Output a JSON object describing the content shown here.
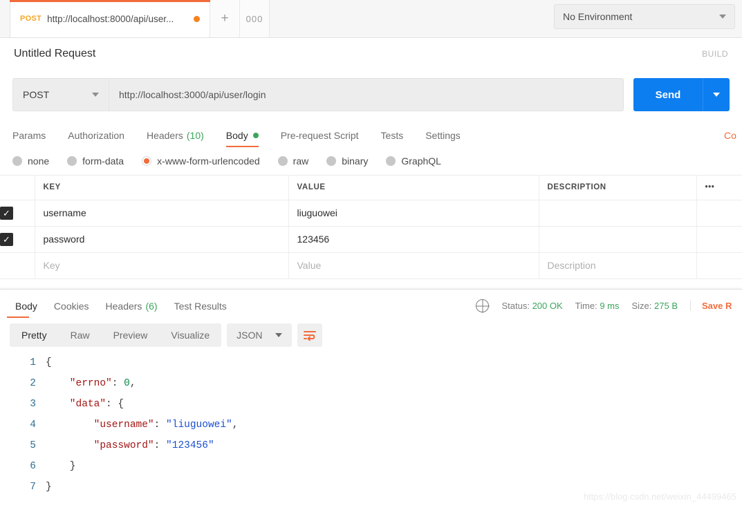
{
  "tabstrip": {
    "request_tab": {
      "method": "POST",
      "url": "http://localhost:8000/api/user...",
      "unsaved_icon": "orange-dot"
    },
    "new_tab_label": "+",
    "tab_options_label": "000",
    "environment": {
      "selected": "No Environment",
      "caret": "chevron-down-icon"
    }
  },
  "request": {
    "title": "Untitled Request",
    "build_label": "BUILD",
    "method": "POST",
    "url": "http://localhost:3000/api/user/login",
    "send_label": "Send",
    "tabs": [
      {
        "label": "Params",
        "count": "",
        "active": false
      },
      {
        "label": "Authorization",
        "count": "",
        "active": false
      },
      {
        "label": "Headers",
        "count": "(10)",
        "active": false
      },
      {
        "label": "Body",
        "count": "",
        "active": true
      },
      {
        "label": "Pre-request Script",
        "count": "",
        "active": false
      },
      {
        "label": "Tests",
        "count": "",
        "active": false
      },
      {
        "label": "Settings",
        "count": "",
        "active": false
      }
    ],
    "code_link": "Co",
    "body_types": [
      {
        "label": "none",
        "selected": false
      },
      {
        "label": "form-data",
        "selected": false
      },
      {
        "label": "x-www-form-urlencoded",
        "selected": true
      },
      {
        "label": "raw",
        "selected": false
      },
      {
        "label": "binary",
        "selected": false
      },
      {
        "label": "GraphQL",
        "selected": false
      }
    ],
    "table": {
      "headers": {
        "key": "KEY",
        "value": "VALUE",
        "description": "DESCRIPTION",
        "more": "•••"
      },
      "rows": [
        {
          "checked": true,
          "key": "username",
          "value": "liuguowei",
          "description": ""
        },
        {
          "checked": true,
          "key": "password",
          "value": "123456",
          "description": ""
        }
      ],
      "placeholder_row": {
        "key": "Key",
        "value": "Value",
        "description": "Description"
      }
    }
  },
  "response": {
    "tabs": [
      {
        "label": "Body",
        "count": "",
        "active": true
      },
      {
        "label": "Cookies",
        "count": "",
        "active": false
      },
      {
        "label": "Headers",
        "count": "(6)",
        "active": false
      },
      {
        "label": "Test Results",
        "count": "",
        "active": false
      }
    ],
    "meta": {
      "status_label": "Status:",
      "status_value": "200 OK",
      "time_label": "Time:",
      "time_value": "9 ms",
      "size_label": "Size:",
      "size_value": "275 B",
      "save_label": "Save R"
    },
    "format_tabs": [
      {
        "label": "Pretty",
        "active": true
      },
      {
        "label": "Raw",
        "active": false
      },
      {
        "label": "Preview",
        "active": false
      },
      {
        "label": "Visualize",
        "active": false
      }
    ],
    "language": "JSON",
    "wrap_icon": "word-wrap-icon",
    "body_lines": [
      {
        "n": "1",
        "tokens": [
          {
            "t": "{",
            "c": "pun"
          }
        ]
      },
      {
        "n": "2",
        "tokens": [
          {
            "t": "    \"errno\"",
            "c": "key"
          },
          {
            "t": ": ",
            "c": "pun"
          },
          {
            "t": "0",
            "c": "num"
          },
          {
            "t": ",",
            "c": "pun"
          }
        ]
      },
      {
        "n": "3",
        "tokens": [
          {
            "t": "    \"data\"",
            "c": "key"
          },
          {
            "t": ": {",
            "c": "pun"
          }
        ]
      },
      {
        "n": "4",
        "tokens": [
          {
            "t": "        \"username\"",
            "c": "key"
          },
          {
            "t": ": ",
            "c": "pun"
          },
          {
            "t": "\"liuguowei\"",
            "c": "str"
          },
          {
            "t": ",",
            "c": "pun"
          }
        ]
      },
      {
        "n": "5",
        "tokens": [
          {
            "t": "        \"password\"",
            "c": "key"
          },
          {
            "t": ": ",
            "c": "pun"
          },
          {
            "t": "\"123456\"",
            "c": "str"
          }
        ]
      },
      {
        "n": "6",
        "tokens": [
          {
            "t": "    }",
            "c": "pun"
          }
        ]
      },
      {
        "n": "7",
        "tokens": [
          {
            "t": "}",
            "c": "pun"
          }
        ]
      }
    ]
  },
  "watermark": "https://blog.csdn.net/weixin_44499465",
  "colors": {
    "accent_orange": "#f26b3a",
    "send_blue": "#0d7ef0",
    "status_green": "#3ba55c",
    "method_amber": "#f5a623"
  }
}
